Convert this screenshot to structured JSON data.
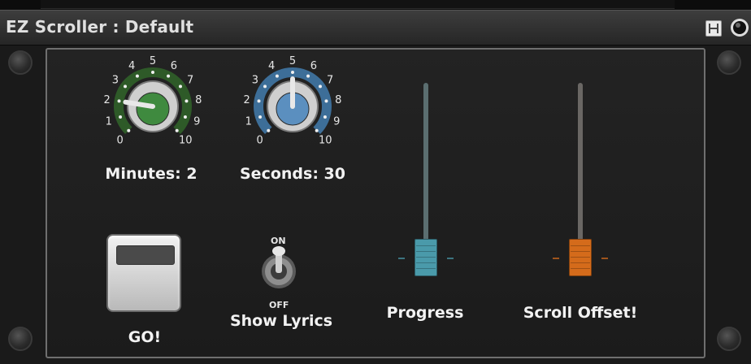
{
  "window": {
    "title": "EZ Scroller : Default",
    "save_icon": "save-icon",
    "power_icon": "power-icon"
  },
  "knobs": [
    {
      "id": "minutes",
      "label": "Minutes: 2",
      "value": 2,
      "range": [
        0,
        10
      ],
      "ticks": [
        "0",
        "1",
        "2",
        "3",
        "4",
        "5",
        "6",
        "7",
        "8",
        "9",
        "10"
      ],
      "color": "#2f7a2f",
      "ring_color": "#2e5a28",
      "cap_color": "#3f8a3f"
    },
    {
      "id": "seconds",
      "label": "Seconds: 30",
      "value": 30,
      "range": [
        0,
        60
      ],
      "ticks": [
        "0",
        "1",
        "2",
        "3",
        "4",
        "5",
        "6",
        "7",
        "8",
        "9",
        "10"
      ],
      "color": "#4a86b8",
      "ring_color": "#3d6e98",
      "cap_color": "#5b8fbf"
    }
  ],
  "go_button": {
    "label": "GO!"
  },
  "show_lyrics": {
    "label": "Show Lyrics",
    "on_label": "ON",
    "off_label": "OFF",
    "state": "on"
  },
  "sliders": [
    {
      "id": "progress",
      "label": "Progress",
      "value": 0.0,
      "thumb_color": "#4a9aaa",
      "track_color": "#5b6e70"
    },
    {
      "id": "scroll_offset",
      "label": "Scroll Offset!",
      "value": 0.0,
      "thumb_color": "#d46b1b",
      "track_color": "#6a6764"
    }
  ],
  "colors": {
    "background": "#1a1a1a",
    "panel_border": "#6f6f6f",
    "label": "#f2f2f2"
  }
}
